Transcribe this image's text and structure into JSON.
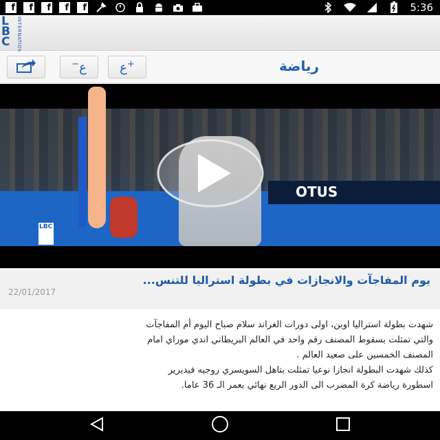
{
  "status_bar": {
    "time": "5:36",
    "notification_icons": [
      "facebook-icon",
      "facebook-icon",
      "facebook-icon",
      "facebook-icon",
      "facebook-icon",
      "tools-icon",
      "alarm-icon",
      "lock-icon",
      "android-icon",
      "camera-icon",
      "briefcase-icon"
    ],
    "fb_glyph": "f",
    "system_icons": [
      "bluetooth-icon",
      "wifi-icon",
      "signal-icon",
      "battery-icon"
    ]
  },
  "header": {
    "logo_text": "LBC",
    "logo_subtext": "INTERNATIONAL"
  },
  "toolbar": {
    "share_icon": "share-icon",
    "font_decrease_label": "ع",
    "font_decrease_sign": "−",
    "font_increase_label": "ع",
    "font_increase_sign": "+",
    "section_title": "رياضة"
  },
  "video": {
    "channel_logo": "LBC",
    "ad_board_text": "OTUS",
    "play_icon": "play-icon"
  },
  "article": {
    "title": "يوم المفاجآت والانجازات في بطولة استراليا للتنس...",
    "date": "22/01/2017",
    "body_lines": [
      "شهدت بطولة استراليا اوبن، اولى دورات الغراند سلام صباح اليوم أم المفاجآت",
      "والتي تمثلت بسقوط المصنف رقم واحد في العالم البريطاني اندي موراي امام",
      "المصنف الخمسين على صعيد العالم .",
      "كذلك شهدت البطولة انجازا نوعيا تمثلت بتاهل السويسري روجيه فيديرير",
      "اسطورة رياضة كرة المضرب الى الدور الربع نهائي بعمر الـ 36 عاما."
    ]
  },
  "nav_bar": {
    "back_icon": "back-icon",
    "home_icon": "home-icon",
    "recent_icon": "recent-apps-icon"
  },
  "colors": {
    "accent": "#1d5aa8",
    "status_bar": "#000000",
    "toolbar_bg": "#f7f7f7"
  }
}
